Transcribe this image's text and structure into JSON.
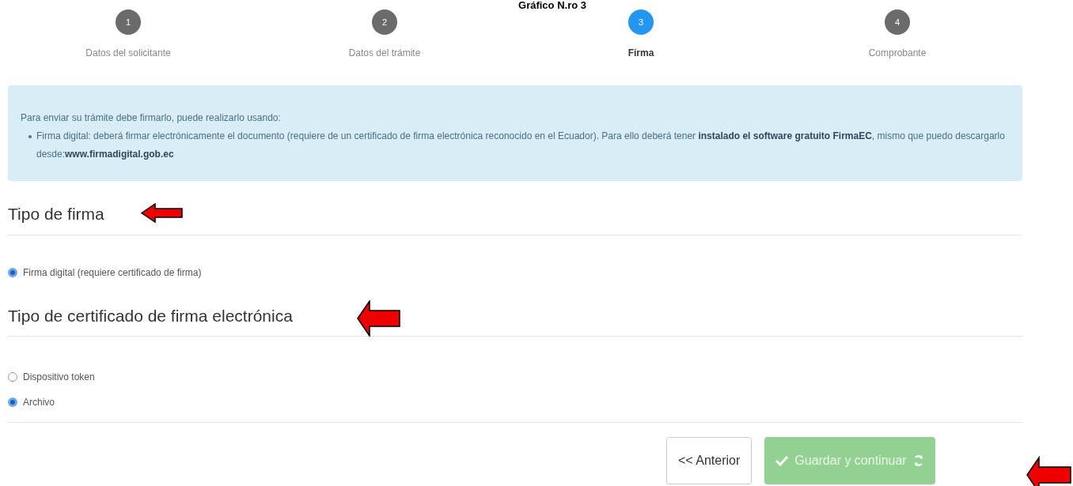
{
  "caption": "Gráfico N.ro 3",
  "steps": [
    {
      "number": "1",
      "label": "Datos del solicitante",
      "selected": false
    },
    {
      "number": "2",
      "label": "Datos del trámite",
      "selected": false
    },
    {
      "number": "3",
      "label": "Firma",
      "selected": true
    },
    {
      "number": "4",
      "label": "Comprobante",
      "selected": false
    }
  ],
  "info": {
    "intro": "Para enviar su trámite debe firmarlo, puede realizarlo usando:",
    "items": [
      "Firma digital: deberá firmar electrónicamente el documento (requiere de un certificado de firma electrónica reconocido en el Ecuador). Para ello deberá tener **instalado el software gratuito FirmaEC**, mismo que puedo descargarlo desde:**www.firmadigital.gob.ec**"
    ]
  },
  "sections": [
    {
      "title": "Tipo de firma",
      "options": [
        {
          "label": "Firma digital (requiere certificado de firma)",
          "selected": true
        }
      ]
    },
    {
      "title": "Tipo de certificado de firma electrónica",
      "options": [
        {
          "label": "Dispositivo token",
          "selected": false
        },
        {
          "label": "Archivo",
          "selected": true
        }
      ]
    }
  ],
  "buttons": [
    {
      "kind": "back",
      "label": "<< Anterior"
    },
    {
      "kind": "submit",
      "label": "Guardar y continuar",
      "disabled": true
    }
  ]
}
